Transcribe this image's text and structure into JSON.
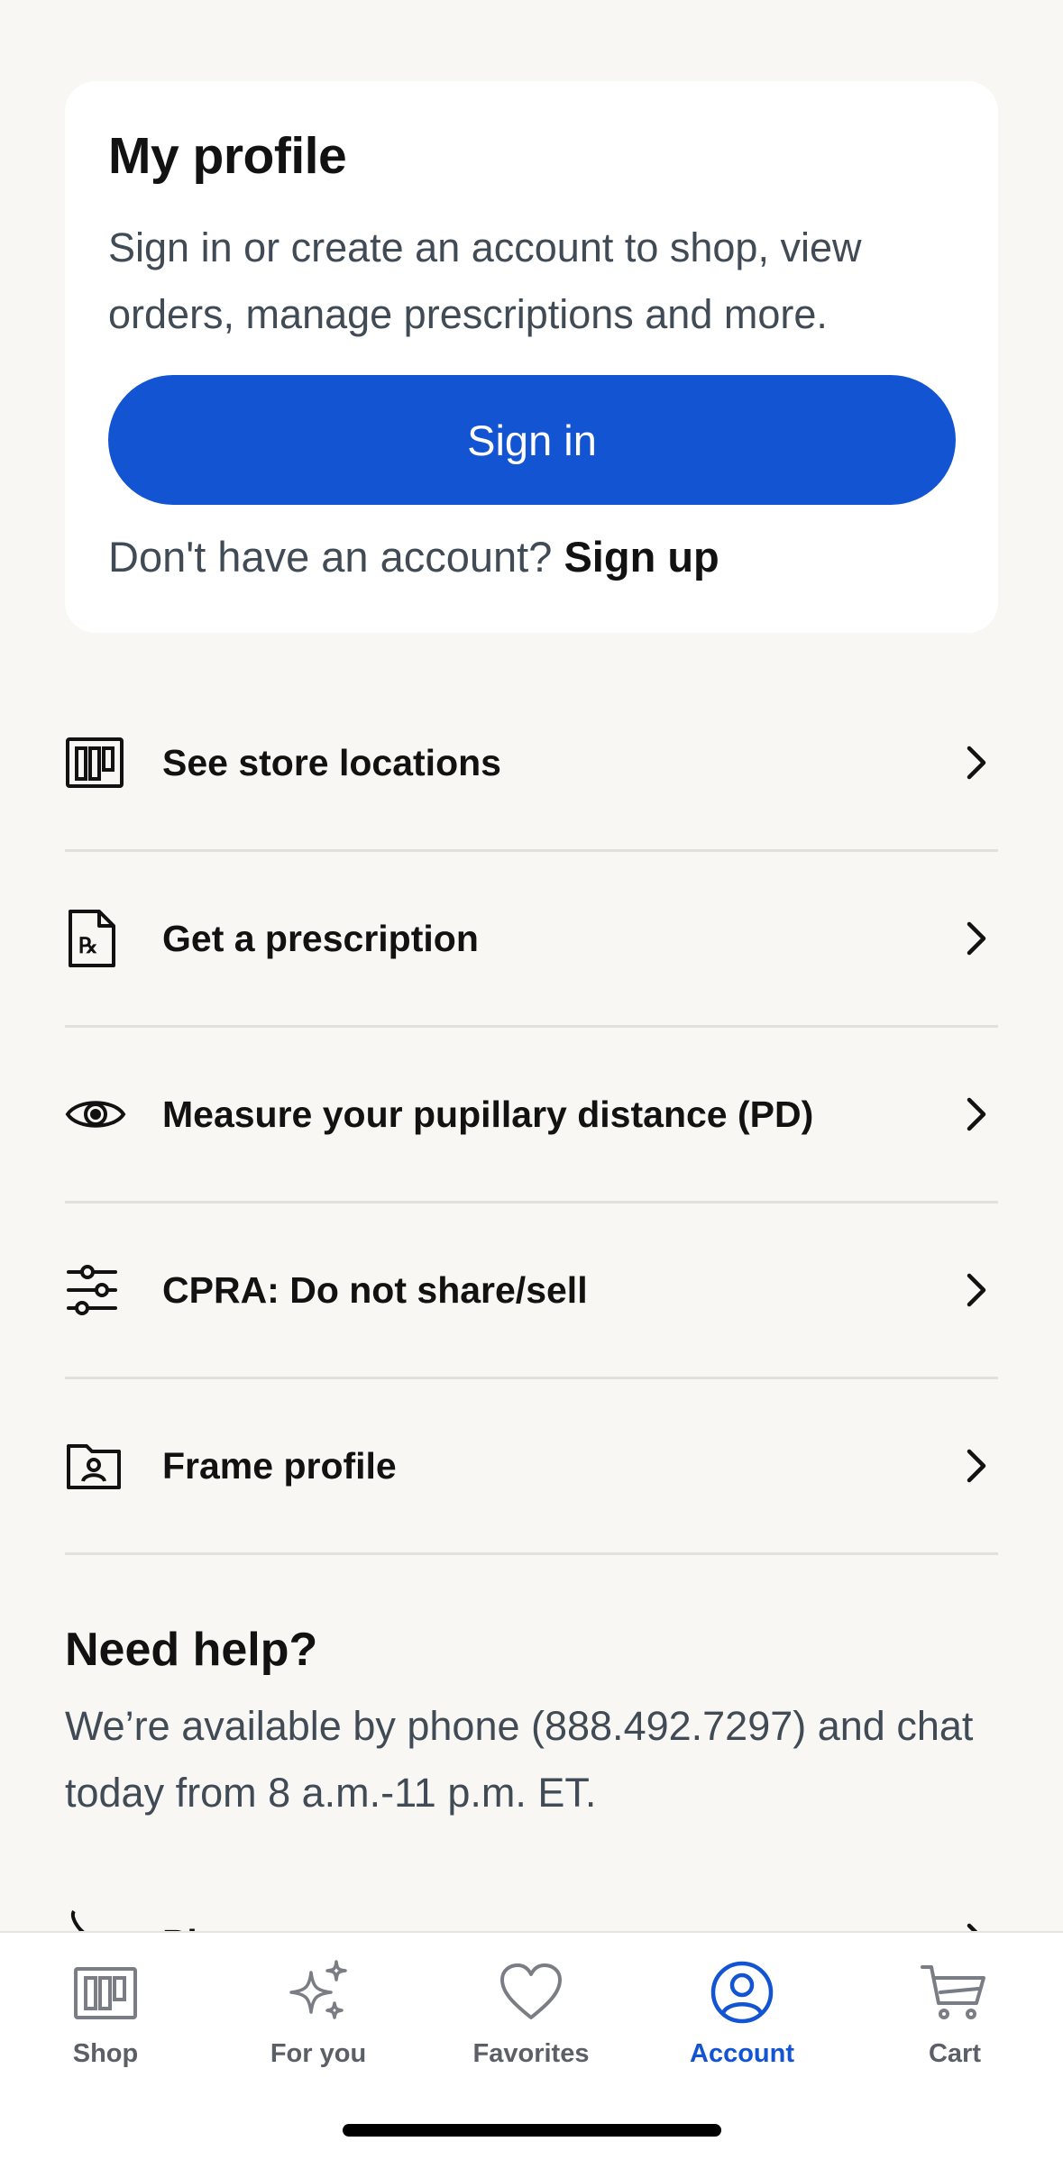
{
  "profile_card": {
    "title": "My profile",
    "description": "Sign in or create an account to shop, view orders, manage prescriptions and more.",
    "sign_in_label": "Sign in",
    "signup_prompt": "Don't have an account?",
    "signup_link": "Sign up"
  },
  "menu": {
    "items": [
      {
        "label": "See store locations",
        "icon": "store-icon"
      },
      {
        "label": "Get a prescription",
        "icon": "prescription-icon"
      },
      {
        "label": "Measure your pupillary distance (PD)",
        "icon": "eye-icon"
      },
      {
        "label": "CPRA: Do not share/sell",
        "icon": "sliders-icon"
      },
      {
        "label": "Frame profile",
        "icon": "frame-profile-icon"
      }
    ],
    "chevron_icon": "chevron-right-icon"
  },
  "help": {
    "title": "Need help?",
    "description": "We’re available by phone (888.492.7297) and chat today from 8 a.m.-11 p.m. ET.",
    "partial_item_label": "Ph"
  },
  "tabbar": {
    "tabs": [
      {
        "label": "Shop",
        "icon": "store-icon",
        "active": false
      },
      {
        "label": "For you",
        "icon": "sparkle-icon",
        "active": false
      },
      {
        "label": "Favorites",
        "icon": "heart-icon",
        "active": false
      },
      {
        "label": "Account",
        "icon": "account-icon",
        "active": true
      },
      {
        "label": "Cart",
        "icon": "cart-icon",
        "active": false
      }
    ]
  },
  "colors": {
    "accent": "#1354d3",
    "background": "#f8f7f4",
    "card": "#ffffff",
    "text_primary": "#121212",
    "text_secondary": "#414b56"
  }
}
